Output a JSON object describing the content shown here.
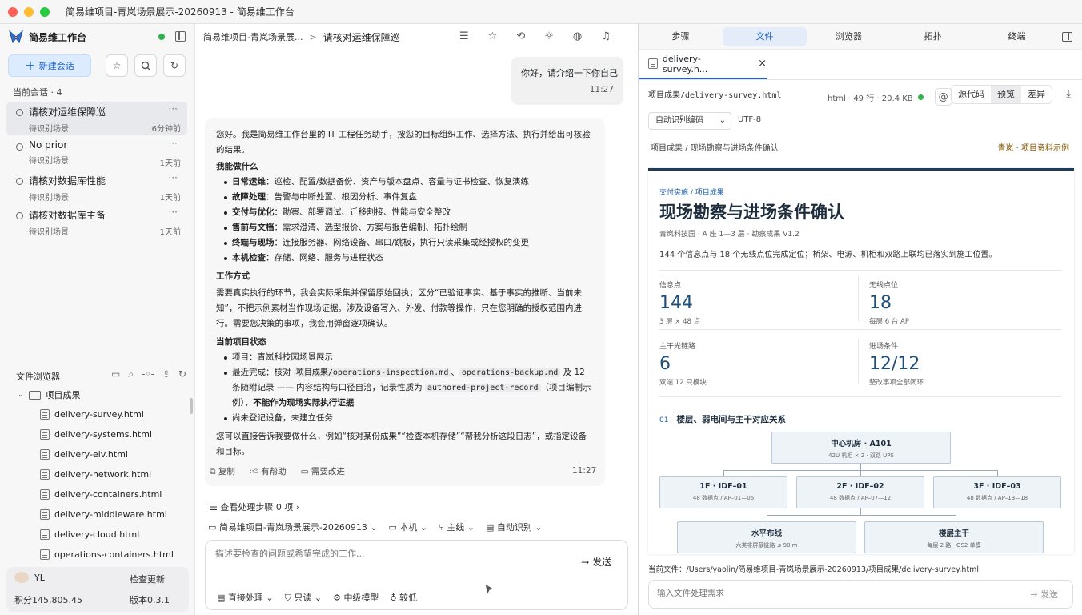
{
  "window": {
    "title": "简易维项目-青岚场景展示-20260913 - 简易维工作台",
    "colors": {
      "close": "#ff5f57",
      "minimize": "#febc2e",
      "zoom": "#28c840",
      "accent": "#1b63c9"
    }
  },
  "sidebar": {
    "app_name": "简易维工作台",
    "status_color": "#2fb34a",
    "new_chat": "新建会话",
    "sessions_heading": "当前会话 · 4",
    "sessions": [
      {
        "title": "请核对运维保障巡",
        "sub": "待识别场景",
        "time": "6分钟前",
        "more": "···"
      },
      {
        "title": "No prior",
        "sub": "待识别场景",
        "time": "1天前",
        "more": "···"
      },
      {
        "title": "请核对数据库性能",
        "sub": "待识别场景",
        "time": "1天前",
        "more": "···"
      },
      {
        "title": "请核对数据库主备",
        "sub": "待识别场景",
        "time": "1天前",
        "more": "···"
      }
    ],
    "file_browser": {
      "title": "文件浏览器",
      "folder": "项目成果",
      "files": [
        "delivery-survey.html",
        "delivery-systems.html",
        "delivery-elv.html",
        "delivery-network.html",
        "delivery-containers.html",
        "delivery-middleware.html",
        "delivery-cloud.html",
        "operations-containers.html"
      ]
    },
    "user": {
      "name": "YL",
      "update": "检查更新",
      "points": "积分145,805.45",
      "version": "版本0.3.1"
    }
  },
  "chat": {
    "breadcrumb_project": "简易维项目-青岚场景展...",
    "breadcrumb_sep": ">",
    "breadcrumb_current": "请核对运维保障巡",
    "user_message": {
      "text": "你好，请介绍一下你自己",
      "time": "11:27"
    },
    "bot": {
      "intro": "您好。我是简易维工作台里的 IT 工程任务助手，按您的目标组织工作、选择方法、执行并给出可核验的结果。",
      "h_can": "我能做什么",
      "can": [
        {
          "k": "日常运维",
          "v": "：巡检、配置/数据备份、资产与版本盘点、容量与证书检查、恢复演练"
        },
        {
          "k": "故障处理",
          "v": "：告警与中断处置、根因分析、事件复盘"
        },
        {
          "k": "交付与优化",
          "v": "：勘察、部署调试、迁移割接、性能与安全整改"
        },
        {
          "k": "售前与文档",
          "v": "：需求澄清、选型报价、方案与报告编制、拓扑绘制"
        },
        {
          "k": "终端与现场",
          "v": "：连接服务器、网络设备、串口/跳板，执行只读采集或经授权的变更"
        },
        {
          "k": "本机检查",
          "v": "：存储、网络、服务与进程状态"
        }
      ],
      "h_how": "工作方式",
      "how": "需要真实执行的环节，我会实际采集并保留原始回执；区分“已验证事实、基于事实的推断、当前未知”，不把示例素材当作现场证据。涉及设备写入、外发、付款等操作，只在您明确的授权范围内进行。需要您决策的事项，我会用弹窗逐项确认。",
      "h_state": "当前项目状态",
      "s1": "项目：青岚科技园场景展示",
      "s2a": "最近完成：核对 ",
      "s2_code1": "项目成果/operations-inspection.md",
      "s2b": "、",
      "s2_code2": "operations-backup.md",
      "s2c": " 及 12 条随附记录 —— 内容结构与口径自洽，记录性质为 ",
      "s2_code3": "authored-project-record",
      "s2d": "（项目编制示例），",
      "s2_bold": "不能作为现场实际执行证据",
      "s3": "尚未登记设备，未建立任务",
      "closing": "您可以直接告诉我要做什么，例如“核对某份成果”“检查本机存储”“帮我分析这段日志”，或指定设备和目标。",
      "copy": "复制",
      "helpful": "有帮助",
      "improve": "需要改进",
      "time": "11:27"
    },
    "steps": "查看处理步骤 0 项",
    "context": {
      "project": "简易维项目-青岚场景展示-20260913",
      "location": "本机",
      "branch": "主线",
      "mode": "自动识别"
    },
    "input": {
      "placeholder": "描述要检查的问题或希望完成的工作...",
      "send": "发送"
    },
    "options": {
      "exec": "直接处理",
      "perm": "只读",
      "model": "中级模型",
      "effort": "较低"
    }
  },
  "panel": {
    "tabs": [
      "步骤",
      "文件",
      "浏览器",
      "拓扑",
      "终端"
    ],
    "active_tab": 1,
    "file_tab": "delivery-survey.h...",
    "path": "项目成果/delivery-survey.html",
    "meta": "html · 49 行 · 20.4 KB",
    "meta_status_color": "#2fb34a",
    "modes": [
      "源代码",
      "预览",
      "差异"
    ],
    "active_mode": 1,
    "encoding_select": "自动识别编码",
    "encoding": "UTF-8",
    "crumb": "项目成果 / 现场勘察与进场条件确认",
    "tag": "青岚 · 项目资料示例",
    "doc": {
      "overline": "交付实施 / 项目成果",
      "title": "现场勘察与进场条件确认",
      "subtitle": "青岚科技园 · A 座 1—3 层 · 勘察成果 V1.2",
      "lead": "144 个信息点与 18 个无线点位完成定位；桥架、电源、机柜和双路上联均已落实到施工位置。",
      "stats": [
        {
          "label": "信息点",
          "value": "144",
          "note": "3 层 × 48 点"
        },
        {
          "label": "无线点位",
          "value": "18",
          "note": "每层 6 台 AP"
        },
        {
          "label": "主干光链路",
          "value": "6",
          "note": "双端 12 只模块"
        },
        {
          "label": "进场条件",
          "value": "12/12",
          "note": "整改事项全部闭环"
        }
      ],
      "section_no": "01",
      "section": "楼层、弱电间与主干对应关系",
      "nodes": [
        {
          "a": "中心机房 · A101",
          "b": "42U 机柜 × 2 · 双路 UPS"
        },
        {
          "a": "1F · IDF–01",
          "b": "48 数据点 / AP–01—06"
        },
        {
          "a": "2F · IDF–02",
          "b": "48 数据点 / AP–07—12"
        },
        {
          "a": "3F · IDF–03",
          "b": "48 数据点 / AP–13—18"
        },
        {
          "a": "水平布线",
          "b": "六类非屏蔽链路 ≤ 90 m"
        },
        {
          "a": "楼层主干",
          "b": "每层 2 路 · OS2 单模"
        }
      ]
    },
    "current_file_label": "当前文件：",
    "current_file": "/Users/yaolin/简易维项目-青岚场景展示-20260913/项目成果/delivery-survey.html",
    "input_placeholder": "输入文件处理需求",
    "send": "发送"
  }
}
